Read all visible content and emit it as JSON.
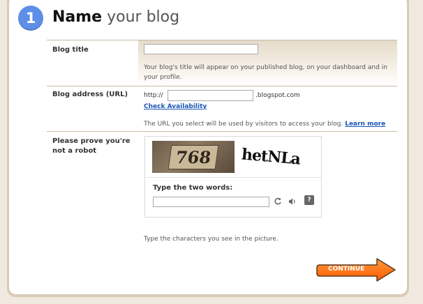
{
  "step": {
    "number": "1",
    "title_strong": "Name",
    "title_light": "your blog"
  },
  "blog_title": {
    "label": "Blog title",
    "value": "",
    "hint": "Your blog's title will appear on your published blog, on your dashboard and in your profile."
  },
  "blog_address": {
    "label": "Blog address (URL)",
    "prefix": "http://",
    "value": "",
    "suffix": ".blogspot.com",
    "check_link": "Check Availability",
    "hint": "The URL you select will be used by visitors to access your blog.",
    "learn_more": "Learn more"
  },
  "captcha": {
    "label": "Please prove you're not a robot",
    "image_text_1": "768",
    "image_text_2": "hetNLa",
    "input_label": "Type the two words:",
    "input_value": "",
    "help": "?",
    "hint": "Type the characters you see in the picture."
  },
  "continue_label": "CONTINUE",
  "colors": {
    "accent": "#5d8ee8",
    "button": "#ff6a00",
    "link": "#1a55b8"
  }
}
